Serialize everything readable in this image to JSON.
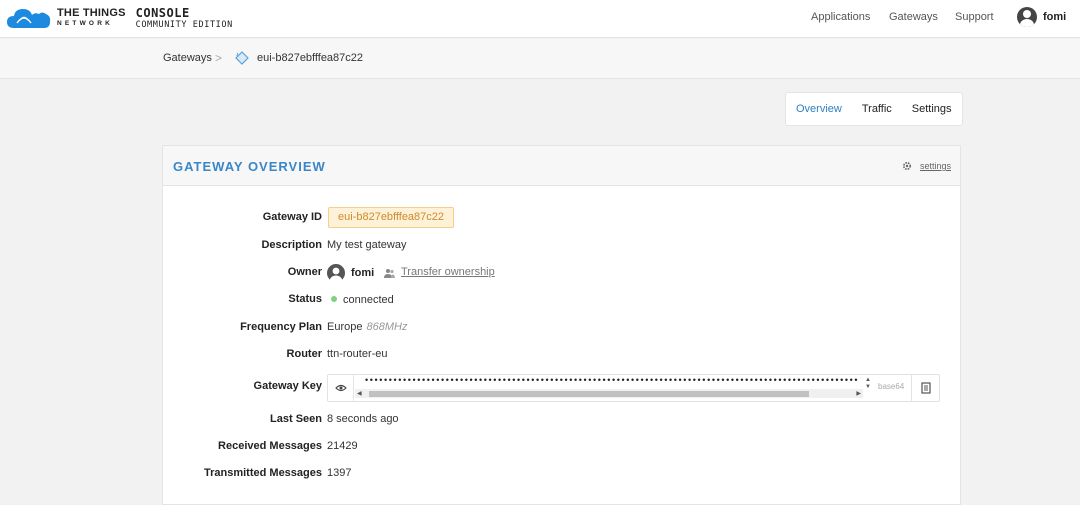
{
  "header": {
    "brand_line1": "THE THINGS",
    "brand_line2": "NETWORK",
    "console_line1": "CONSOLE",
    "console_line2": "COMMUNITY EDITION",
    "nav": [
      "Applications",
      "Gateways",
      "Support"
    ],
    "user": "fomi",
    "brand_color": "#1d8ae0"
  },
  "breadcrumb": {
    "root": "Gateways",
    "separator": ">",
    "current": "eui-b827ebfffea87c22"
  },
  "tabs": [
    {
      "label": "Overview",
      "active": true
    },
    {
      "label": "Traffic",
      "active": false
    },
    {
      "label": "Settings",
      "active": false
    }
  ],
  "panel": {
    "title": "GATEWAY OVERVIEW",
    "settings_link": "settings",
    "rows": {
      "gateway_id": {
        "label": "Gateway ID",
        "value": "eui-b827ebfffea87c22"
      },
      "description": {
        "label": "Description",
        "value": "My test gateway"
      },
      "owner": {
        "label": "Owner",
        "value": "fomi",
        "transfer_link": "Transfer ownership"
      },
      "status": {
        "label": "Status",
        "value": "connected",
        "color": "#7fd27f"
      },
      "frequency_plan": {
        "label": "Frequency Plan",
        "value": "Europe",
        "unit": "868MHz"
      },
      "router": {
        "label": "Router",
        "value": "ttn-router-eu"
      },
      "gateway_key": {
        "label": "Gateway Key",
        "masked": "••••••••••••••••••••••••••••••••••••••••••••••••••••••••••••••••••••••••••••••••••••••••••••••••••••••••",
        "format": "base64"
      },
      "last_seen": {
        "label": "Last Seen",
        "value": "8 seconds ago"
      },
      "received": {
        "label": "Received Messages",
        "value": "21429"
      },
      "transmitted": {
        "label": "Transmitted Messages",
        "value": "1397"
      }
    }
  },
  "icons": {
    "logo": "cloud-logo-icon",
    "user": "user-avatar-icon",
    "gateway": "gateway-icon",
    "gear": "gear-icon",
    "transfer": "users-icon",
    "eye": "eye-icon",
    "copy": "copy-icon"
  },
  "colors": {
    "accent": "#3a87c8",
    "badge_bg": "#fdf1d8",
    "badge_text": "#d08a2b"
  }
}
